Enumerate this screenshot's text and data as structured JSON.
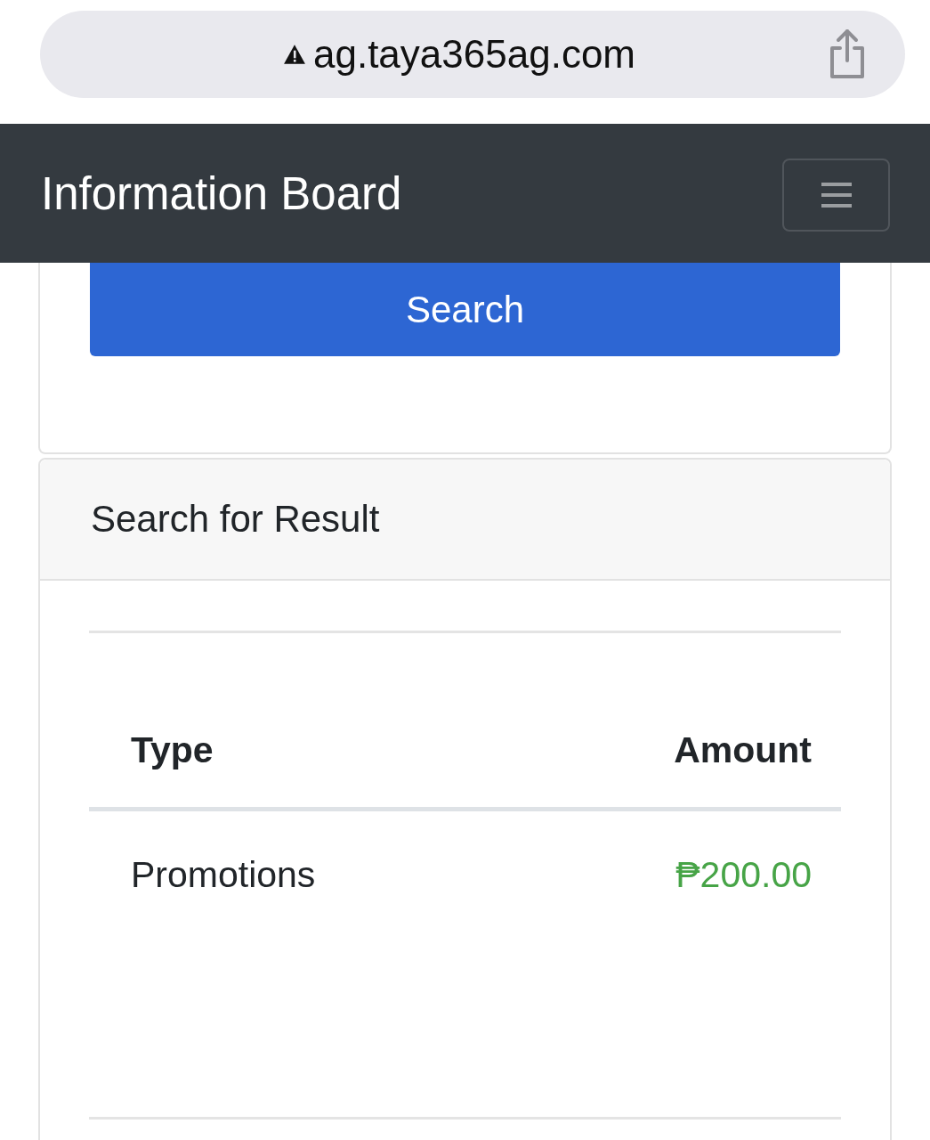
{
  "browser": {
    "url": "ag.taya365ag.com"
  },
  "navbar": {
    "title": "Information Board"
  },
  "search_card": {
    "button": "Search"
  },
  "result_card": {
    "title": "Search for Result",
    "table": {
      "columns": [
        "Type",
        "Amount"
      ],
      "rows": [
        {
          "type": "Promotions",
          "amount": "₱200.00"
        }
      ]
    }
  }
}
